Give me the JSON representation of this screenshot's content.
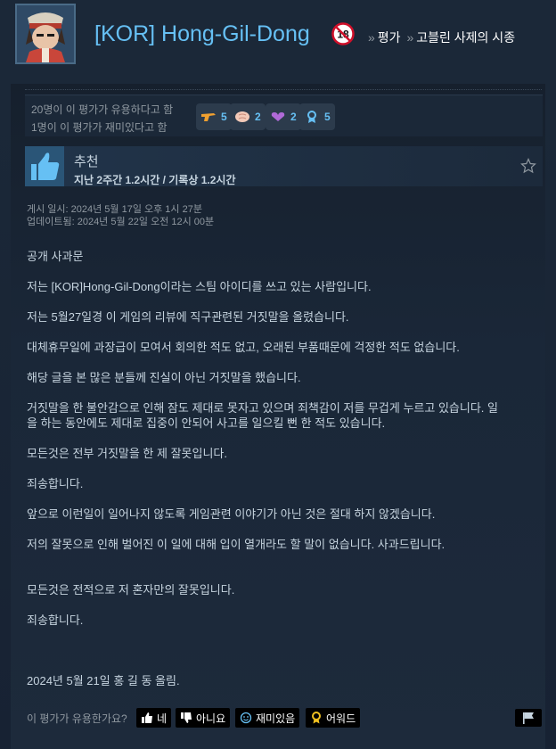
{
  "header": {
    "username": "[KOR] Hong-Gil-Dong",
    "age_badge": "18",
    "breadcrumb_sep1": "»",
    "breadcrumb_1": "평가",
    "breadcrumb_sep2": "»",
    "breadcrumb_2": "고블린 사제의 시종"
  },
  "stats": {
    "helpful": "20명이 이 평가가 유용하다고 함",
    "funny": "1명이 이 평가가 재미있다고 함",
    "awards": [
      {
        "icon": "award-gun-icon",
        "count": "5"
      },
      {
        "icon": "award-brain-icon",
        "count": "2"
      },
      {
        "icon": "award-heart-hands-icon",
        "count": "2"
      },
      {
        "icon": "award-medal-icon",
        "count": "5"
      }
    ]
  },
  "recommendation": {
    "title": "추천",
    "hours": "지난 2주간 1.2시간 / 기록상 1.2시간"
  },
  "dates": {
    "posted": "게시 일시: 2024년 5월 17일 오후 1시 27분",
    "updated": "업데이트됨: 2024년 5월 22일 오전 12시 00분"
  },
  "body": {
    "p1": "공개 사과문",
    "p2": "저는 [KOR]Hong-Gil-Dong이라는 스팀 아이디를 쓰고 있는 사람입니다.",
    "p3": "저는 5월27일경 이 게임의 리뷰에 직구관련된 거짓말을 올렸습니다.",
    "p4": "대체휴무일에 과장급이 모여서 회의한 적도 없고, 오래된 부품때문에 걱정한 적도 없습니다.",
    "p5": "해당 글을 본 많은 분들께 진실이 아닌 거짓말을 했습니다.",
    "p6a": "거짓말을 한 불안감으로 인해 잠도 제대로 못자고 있으며 죄책감이 저를 무겁게 누르고 있습니다. 일",
    "p6b": "을 하는 동안에도 제대로 집중이 안되어 사고를 일으킬 뻔 한 적도 있습니다.",
    "p7": "모든것은 전부 거짓말을 한 제 잘못입니다.",
    "p8": "죄송합니다.",
    "p9": "앞으로 이런일이 일어나지 않도록 게임관련 이야기가 아닌 것은 절대 하지 않겠습니다.",
    "p10": "저의 잘못으로 인해 벌어진 이 일에 대해 입이 열개라도 할 말이 없습니다. 사과드립니다.",
    "p11": "모든것은 전적으로 저 혼자만의 잘못입니다.",
    "p12": "죄송합니다.",
    "p13": "2024년 5월 21일 홍 길 동 올림."
  },
  "footer": {
    "question": "이 평가가 유용한가요?",
    "yes": "네",
    "no": "아니요",
    "funny": "재미있음",
    "award": "어워드"
  },
  "colors": {
    "accent": "#66c0f4",
    "background": "#1b2838"
  }
}
